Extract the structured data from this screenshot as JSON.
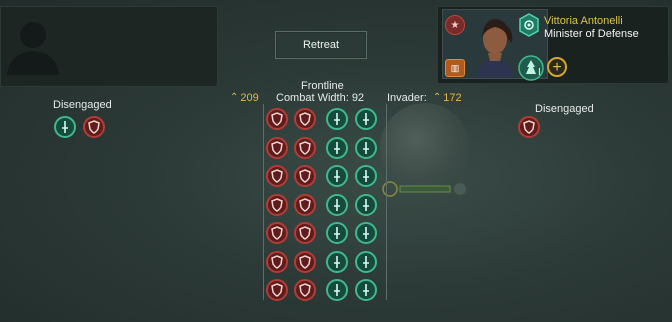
{
  "retreat_button": {
    "label": "Retreat"
  },
  "frontline": {
    "title": "Frontline",
    "combat_width_label": "Combat Width:",
    "combat_width_value": "92"
  },
  "attacker": {
    "power": "209"
  },
  "invader": {
    "label": "Invader:",
    "power": "172"
  },
  "disengaged_left": {
    "label": "Disengaged",
    "ships": [
      "green",
      "red"
    ]
  },
  "disengaged_right": {
    "label": "Disengaged",
    "ships": [
      "red"
    ]
  },
  "leader": {
    "name": "Vittoria Antonelli",
    "title": "Minister of Defense",
    "trait_level": "I"
  },
  "frontline_grid": {
    "rows": [
      [
        "red",
        "red",
        "green",
        "green"
      ],
      [
        "red",
        "red",
        "green",
        "green"
      ],
      [
        "red",
        "red",
        "green",
        "green"
      ],
      [
        "red",
        "red",
        "green",
        "green"
      ],
      [
        "red",
        "red",
        "green",
        "green"
      ],
      [
        "red",
        "red",
        "green",
        "green"
      ],
      [
        "red",
        "red",
        "green",
        "green"
      ]
    ]
  },
  "colors": {
    "friendly": "#3fb98a",
    "hostile": "#b53b36",
    "accent": "#e8b646",
    "leader_name": "#d8c44a"
  }
}
